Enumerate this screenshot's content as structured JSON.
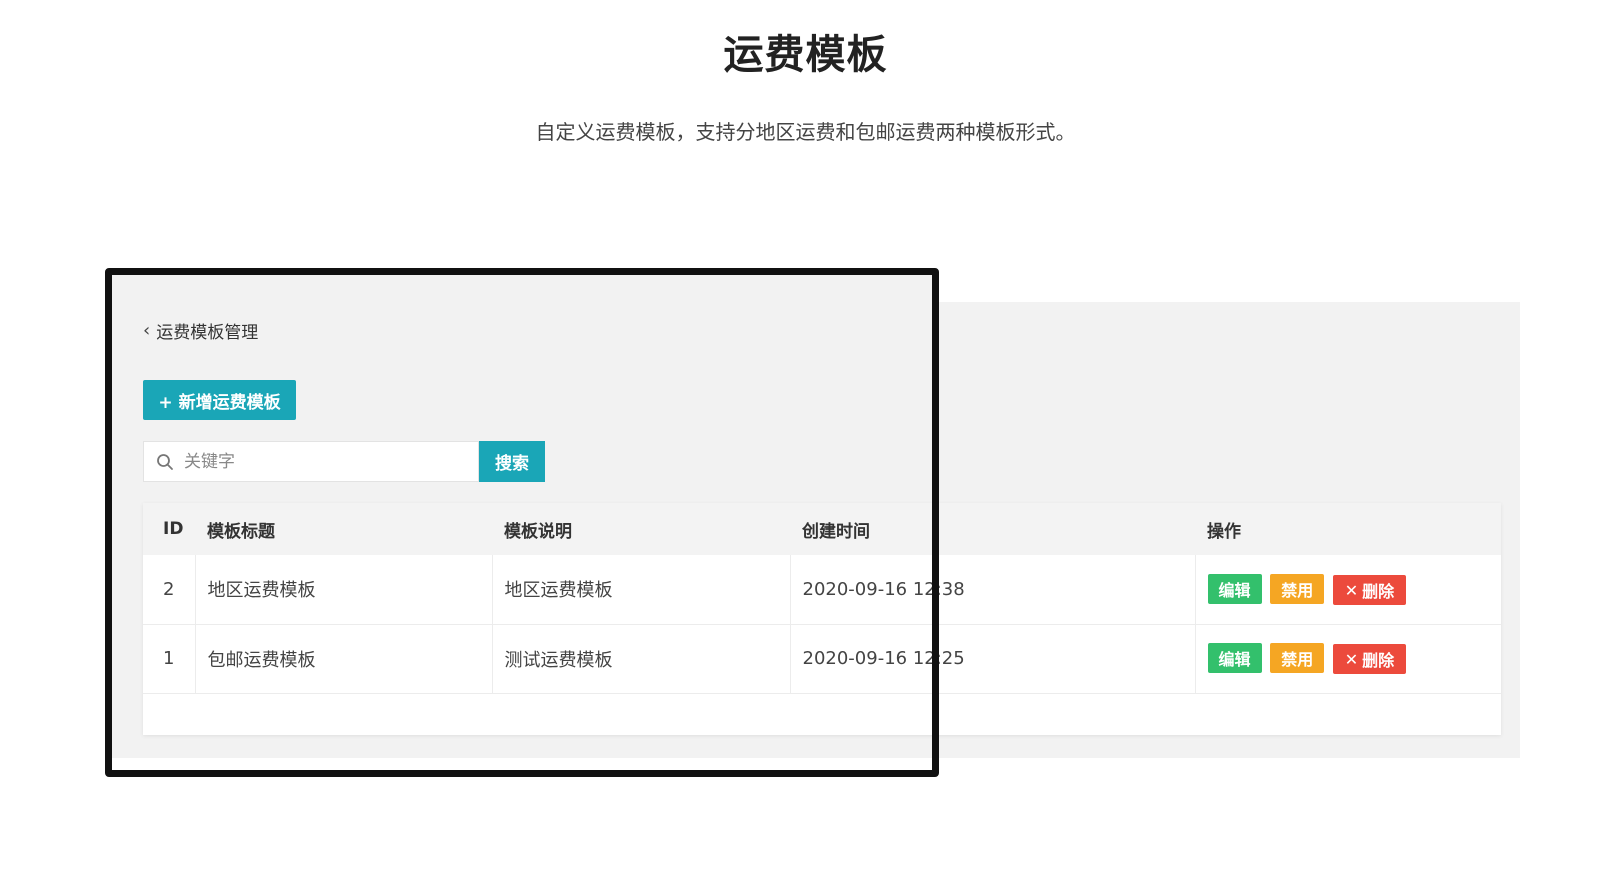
{
  "header": {
    "title": "运费模板",
    "subtitle": "自定义运费模板，支持分地区运费和包邮运费两种模板形式。"
  },
  "app": {
    "breadcrumb": "运费模板管理",
    "add_button": "+ 新增运费模板",
    "search": {
      "placeholder": "关键字",
      "button": "搜索"
    },
    "table": {
      "headers": {
        "id": "ID",
        "title": "模板标题",
        "desc": "模板说明",
        "created": "创建时间",
        "actions": "操作"
      },
      "rows": [
        {
          "id": "2",
          "title": "地区运费模板",
          "desc": "地区运费模板",
          "created": "2020-09-16 12:38"
        },
        {
          "id": "1",
          "title": "包邮运费模板",
          "desc": "测试运费模板",
          "created": "2020-09-16 12:25"
        }
      ],
      "actions": {
        "edit": "编辑",
        "disable": "禁用",
        "delete": "删除"
      }
    }
  },
  "colors": {
    "accent": "#1aa6b7",
    "edit": "#33c06c",
    "disable": "#f5a623",
    "delete": "#ec4a3c"
  }
}
